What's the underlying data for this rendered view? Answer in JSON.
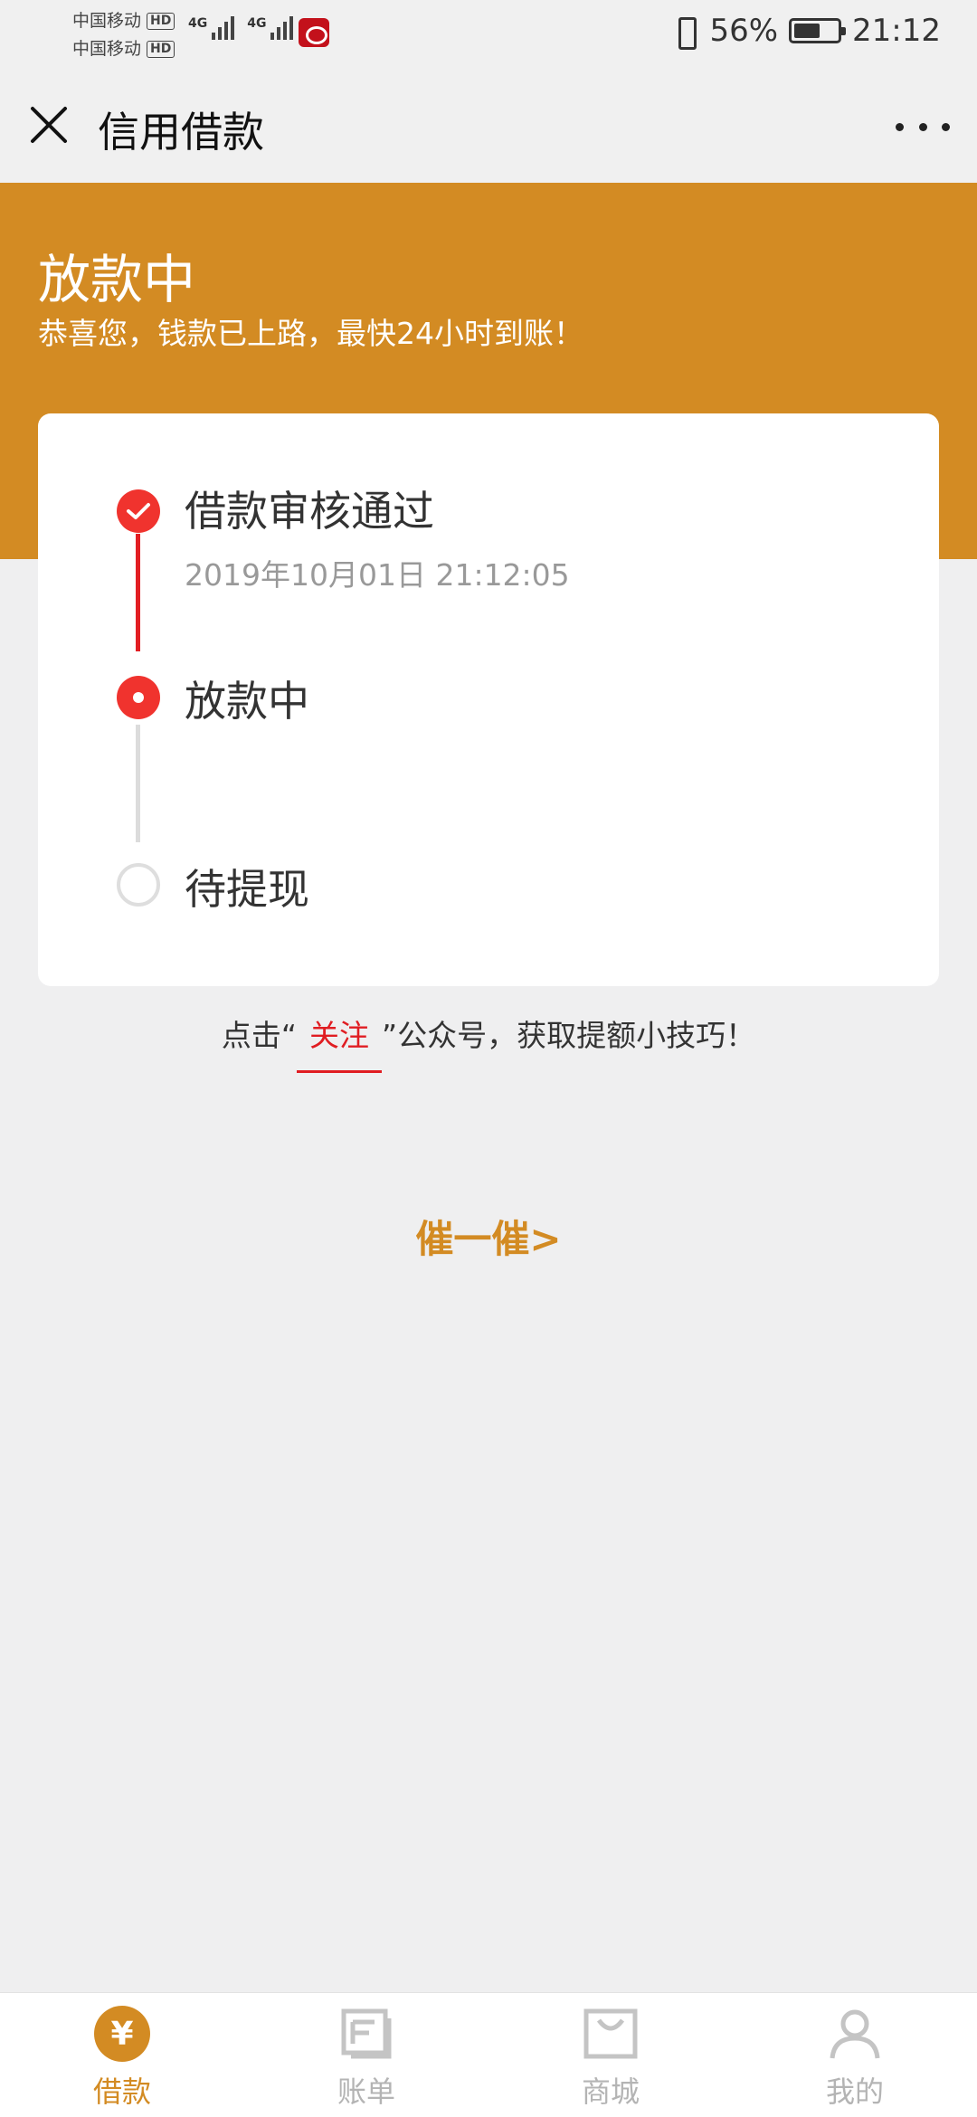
{
  "status_bar": {
    "carrier_1": "中国移动",
    "carrier_2": "中国移动",
    "hd": "HD",
    "network": "4G",
    "battery_percent": "56%",
    "time": "21:12"
  },
  "title_bar": {
    "title": "信用借款"
  },
  "banner": {
    "status": "放款中",
    "message": "恭喜您，钱款已上路，最快24小时到账！"
  },
  "progress": {
    "steps": [
      {
        "label": "借款审核通过",
        "time": "2019年10月01日 21:12:05",
        "state": "done"
      },
      {
        "label": "放款中",
        "state": "current"
      },
      {
        "label": "待提现",
        "state": "pending"
      }
    ]
  },
  "follow_tip": {
    "prefix": "点击“",
    "link": "关注",
    "suffix": "”公众号，获取提额小技巧！"
  },
  "urge": {
    "label": "催一催>"
  },
  "tabs": [
    {
      "label": "借款",
      "icon": "yen-icon",
      "active": true
    },
    {
      "label": "账单",
      "icon": "bill-icon",
      "active": false
    },
    {
      "label": "商城",
      "icon": "shop-bag-icon",
      "active": false
    },
    {
      "label": "我的",
      "icon": "user-icon",
      "active": false
    }
  ],
  "colors": {
    "brand_orange": "#d38b23",
    "progress_red": "#f0332e",
    "link_red": "#e01d22"
  }
}
